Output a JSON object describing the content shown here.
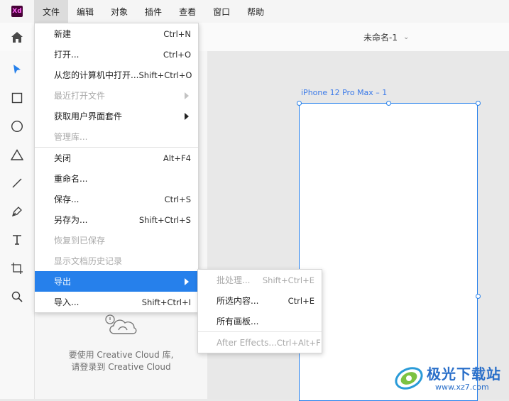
{
  "app": {
    "logo_text": "Xd",
    "brand_color": "#470137",
    "accent_color": "#2680eb"
  },
  "menubar": {
    "items": [
      {
        "label": "文件"
      },
      {
        "label": "编辑"
      },
      {
        "label": "对象"
      },
      {
        "label": "插件"
      },
      {
        "label": "查看"
      },
      {
        "label": "窗口"
      },
      {
        "label": "帮助"
      }
    ]
  },
  "document": {
    "title": "未命名-1"
  },
  "tools": [
    "select-icon",
    "rectangle-icon",
    "ellipse-icon",
    "triangle-icon",
    "line-icon",
    "pen-icon",
    "text-icon",
    "artboard-icon",
    "zoom-icon"
  ],
  "file_menu": {
    "items": [
      {
        "label": "新建",
        "shortcut": "Ctrl+N",
        "disabled": false
      },
      {
        "label": "打开...",
        "shortcut": "Ctrl+O",
        "disabled": false
      },
      {
        "label": "从您的计算机中打开...",
        "shortcut": "Shift+Ctrl+O",
        "disabled": false
      },
      {
        "label": "最近打开文件",
        "shortcut": "",
        "disabled": true,
        "submenu": true
      },
      {
        "label": "获取用户界面套件",
        "shortcut": "",
        "disabled": false,
        "submenu": true
      },
      {
        "label": "管理库...",
        "shortcut": "",
        "disabled": true
      },
      {
        "label": "关闭",
        "shortcut": "Alt+F4",
        "disabled": false
      },
      {
        "label": "重命名...",
        "shortcut": "",
        "disabled": false
      },
      {
        "label": "保存...",
        "shortcut": "Ctrl+S",
        "disabled": false
      },
      {
        "label": "另存为...",
        "shortcut": "Shift+Ctrl+S",
        "disabled": false
      },
      {
        "label": "恢复到已保存",
        "shortcut": "",
        "disabled": true
      },
      {
        "label": "显示文档历史记录",
        "shortcut": "",
        "disabled": true
      },
      {
        "label": "导出",
        "shortcut": "",
        "disabled": false,
        "submenu": true,
        "highlighted": true
      },
      {
        "label": "导入...",
        "shortcut": "Shift+Ctrl+I",
        "disabled": false
      }
    ]
  },
  "export_submenu": {
    "items": [
      {
        "label": "批处理...",
        "shortcut": "Shift+Ctrl+E",
        "disabled": true
      },
      {
        "label": "所选内容...",
        "shortcut": "Ctrl+E",
        "disabled": false
      },
      {
        "label": "所有画板...",
        "shortcut": "",
        "disabled": false
      },
      {
        "label": "After Effects...",
        "shortcut": "Ctrl+Alt+F",
        "disabled": true
      }
    ]
  },
  "library_panel": {
    "message_line1": "要使用 Creative Cloud 库,",
    "message_line2": "请登录到 Creative Cloud"
  },
  "artboard": {
    "label": "iPhone 12 Pro Max – 1"
  },
  "watermark": {
    "text": "极光下载站",
    "url": "www.xz7.com"
  }
}
